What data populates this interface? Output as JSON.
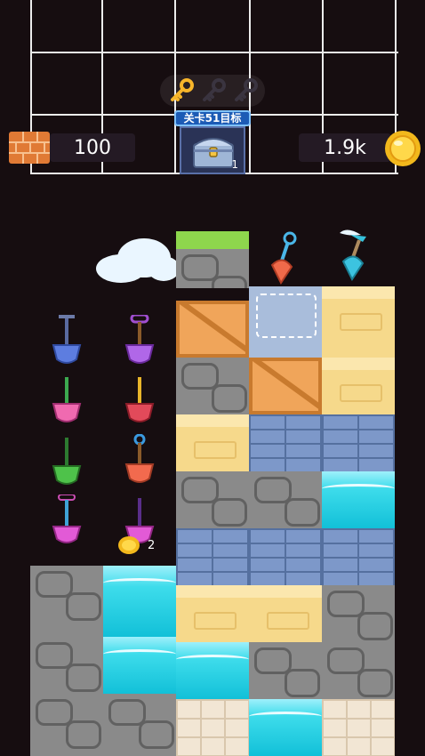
{
  "hud": {
    "bricks": "100",
    "coins": "1.9k",
    "goal_label": "关卡51目标",
    "goal_count": "1",
    "keys_collected": 1,
    "keys_total": 3
  },
  "board": {
    "coin_pickup_count": "2"
  },
  "colors": {
    "background": "#160d10",
    "grid_line": "#ececec",
    "goal_blue": "#1c5bb5"
  },
  "icons": [
    "brick-icon",
    "coin-icon",
    "key-icon",
    "treasure-chest-icon",
    "shovel-icon",
    "cloud-icon"
  ]
}
